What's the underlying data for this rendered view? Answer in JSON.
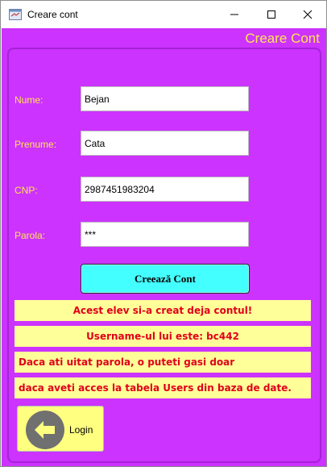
{
  "window": {
    "title": "Creare cont",
    "minimize": "minimize",
    "maximize": "maximize",
    "close": "close"
  },
  "header": {
    "title": "Creare Cont"
  },
  "form": {
    "nume_label": "Nume:",
    "nume_value": "Bejan",
    "prenume_label": "Prenume:",
    "prenume_value": "Cata",
    "cnp_label": "CNP:",
    "cnp_value": "2987451983204",
    "parola_label": "Parola:",
    "parola_value": "***",
    "create_button": "Creează Cont"
  },
  "messages": {
    "line1": "Acest elev si-a creat deja contul!",
    "line2": "Username-ul lui este: bc442",
    "line3": "Daca ati uitat parola, o puteti gasi doar",
    "line4": "daca aveti acces la tabela Users din baza de date."
  },
  "login": {
    "label": "Login",
    "icon": "arrow-left-icon"
  },
  "colors": {
    "background": "#cc33ff",
    "label": "#ffe64d",
    "button": "#44ffff",
    "message_bg": "#ffff99",
    "message_text": "#e0001b"
  }
}
